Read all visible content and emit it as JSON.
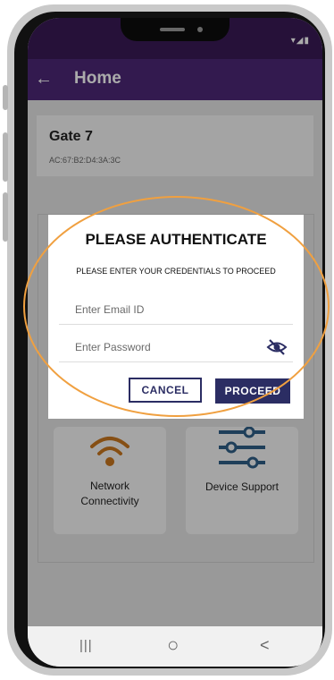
{
  "status_bar": {
    "icons": "▾◢▮"
  },
  "app_bar": {
    "back_icon": "←",
    "title": "Home"
  },
  "device": {
    "name": "Gate 7",
    "mac": "AC:67:B2:D4:3A:3C"
  },
  "tiles": [
    {
      "label_line1": "Network",
      "label_line2": "Connectivity",
      "icon": "wifi-icon"
    },
    {
      "label": "Device Support",
      "icon": "sliders-icon"
    }
  ],
  "dialog": {
    "title": "PLEASE AUTHENTICATE",
    "subtitle": "PLEASE ENTER YOUR CREDENTIALS TO PROCEED",
    "email_placeholder": "Enter Email ID",
    "password_placeholder": "Enter Password",
    "cancel_label": "CANCEL",
    "proceed_label": "PROCEED"
  },
  "nav": {
    "recent": "|||",
    "home": "○",
    "back": "<"
  },
  "colors": {
    "purple": "#4c2877",
    "navy": "#2b2d63",
    "orange_highlight": "#f0a040",
    "wifi_orange": "#c8761e",
    "slider_blue": "#2f5f86"
  }
}
